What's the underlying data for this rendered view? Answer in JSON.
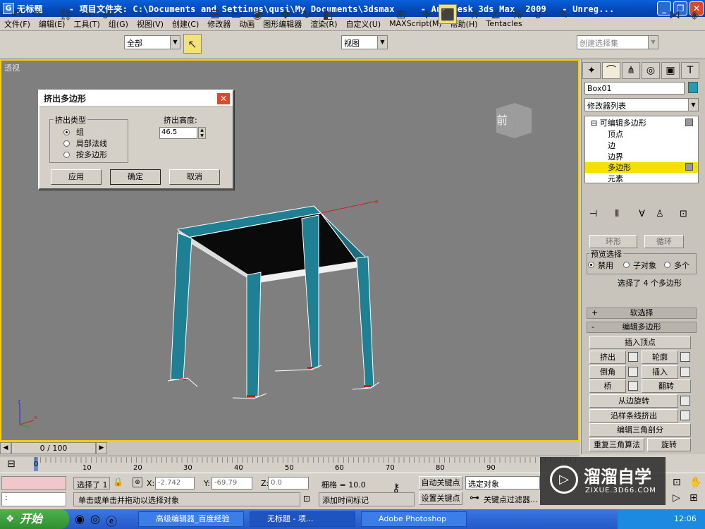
{
  "window": {
    "title": "无标题     - 项目文件夹: C:\\Documents and Settings\\qusi\\My Documents\\3dsmax     - Autodesk 3ds Max  2009   - Unreg...",
    "icon": "3dsmax-app-icon"
  },
  "menu": [
    "文件(F)",
    "编辑(E)",
    "工具(T)",
    "组(G)",
    "视图(V)",
    "创建(C)",
    "修改器",
    "动画",
    "图形编辑器",
    "渲染(R)",
    "自定义(U)",
    "MAXScript(M)",
    "帮助(H)",
    "Tentacles"
  ],
  "toolbar": {
    "selection_filter": "全部",
    "reference_coord": "视图",
    "named_selection_placeholder": "创建选择集"
  },
  "viewport": {
    "label": "透视",
    "viewcube_text": "前",
    "colors": {
      "background": "#7f7f7f",
      "border": "#f5d000",
      "object": "#1f7f93"
    }
  },
  "dialog": {
    "title": "挤出多边形",
    "group_label": "挤出类型",
    "options": [
      "组",
      "局部法线",
      "按多边形"
    ],
    "selected_option": "组",
    "height_label": "挤出高度:",
    "height_value": "46.5",
    "buttons": {
      "apply": "应用",
      "ok": "确定",
      "cancel": "取消"
    }
  },
  "command_panel": {
    "object_name": "Box01",
    "modifier_list": "修改器列表",
    "stack": {
      "root": "可编辑多边形",
      "items": [
        "顶点",
        "边",
        "边界",
        "多边形",
        "元素"
      ],
      "active": "多边形"
    },
    "top_buttons": {
      "ring": "环形",
      "loop": "循环"
    },
    "preview": {
      "title": "预览选择",
      "options": [
        "禁用",
        "子对象",
        "多个"
      ],
      "selected": "禁用"
    },
    "selection_info": "选择了 4 个多边形",
    "rollouts": {
      "soft": {
        "sign": "+",
        "label": "软选择"
      },
      "edit": {
        "sign": "-",
        "label": "编辑多边形"
      }
    },
    "edit_buttons": {
      "insert_vertex": "插入顶点",
      "extrude": "挤出",
      "outline": "轮廓",
      "bevel": "倒角",
      "inset": "插入",
      "bridge": "桥",
      "flip": "翻转",
      "hinge": "从边旋转",
      "extrude_spline": "沿样条线挤出",
      "edit_tri": "编辑三角剖分",
      "retriangulate": "重复三角算法",
      "turn": "旋转"
    }
  },
  "timeline": {
    "frame_display": "0 / 100",
    "ticks": [
      "0",
      "10",
      "20",
      "30",
      "40",
      "50",
      "60",
      "70",
      "80",
      "90"
    ]
  },
  "status": {
    "selected": "选择了 1",
    "x_label": "X:",
    "x_value": "-2.742",
    "y_label": "Y:",
    "y_value": "-69.79",
    "z_label": "Z:",
    "z_value": "0.0",
    "grid": "栅格 = 10.0",
    "auto_key": "自动关键点",
    "set_key": "设置关键点",
    "key_filter_select": "选定对象",
    "key_filters": "关键点过滤器...",
    "prompt": "单击或单击并拖动以选择对象",
    "add_time_tag": "添加时间标记"
  },
  "taskbar": {
    "start": "开始",
    "tasks": [
      "高级编辑器_百度经验",
      "无标题      - 项...",
      "Adobe Photoshop"
    ],
    "clock": "12:06"
  },
  "watermark": {
    "brand": "溜溜自学",
    "url": "ZIXUE.3D66.COM"
  }
}
